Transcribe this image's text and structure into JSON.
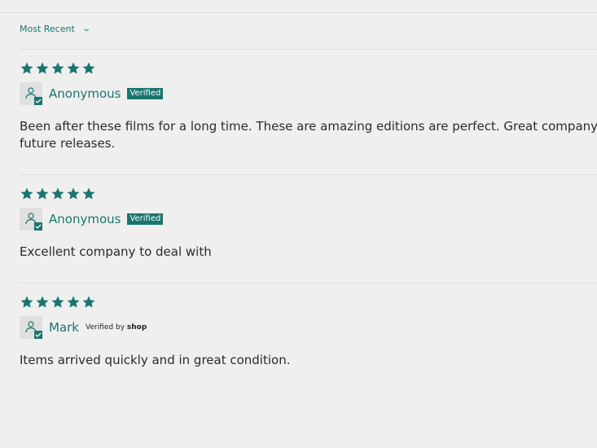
{
  "sort": {
    "label": "Most Recent",
    "chevron": "chevron-down-icon"
  },
  "colors": {
    "accent": "#18766d",
    "background": "#efefef"
  },
  "reviews": [
    {
      "rating": 5,
      "author": "Anonymous",
      "badge": "Verified",
      "body_line1": "Been after these films for a long time. These are amazing editions are perfect. Great company",
      "body_line2": "future releases."
    },
    {
      "rating": 5,
      "author": "Anonymous",
      "badge": "Verified",
      "body_line1": "Excellent company to deal with"
    },
    {
      "rating": 5,
      "author": "Mark",
      "badge_prefix": "Verified by",
      "badge_brand": "shop",
      "body_line1": "Items arrived quickly and in great condition."
    }
  ]
}
